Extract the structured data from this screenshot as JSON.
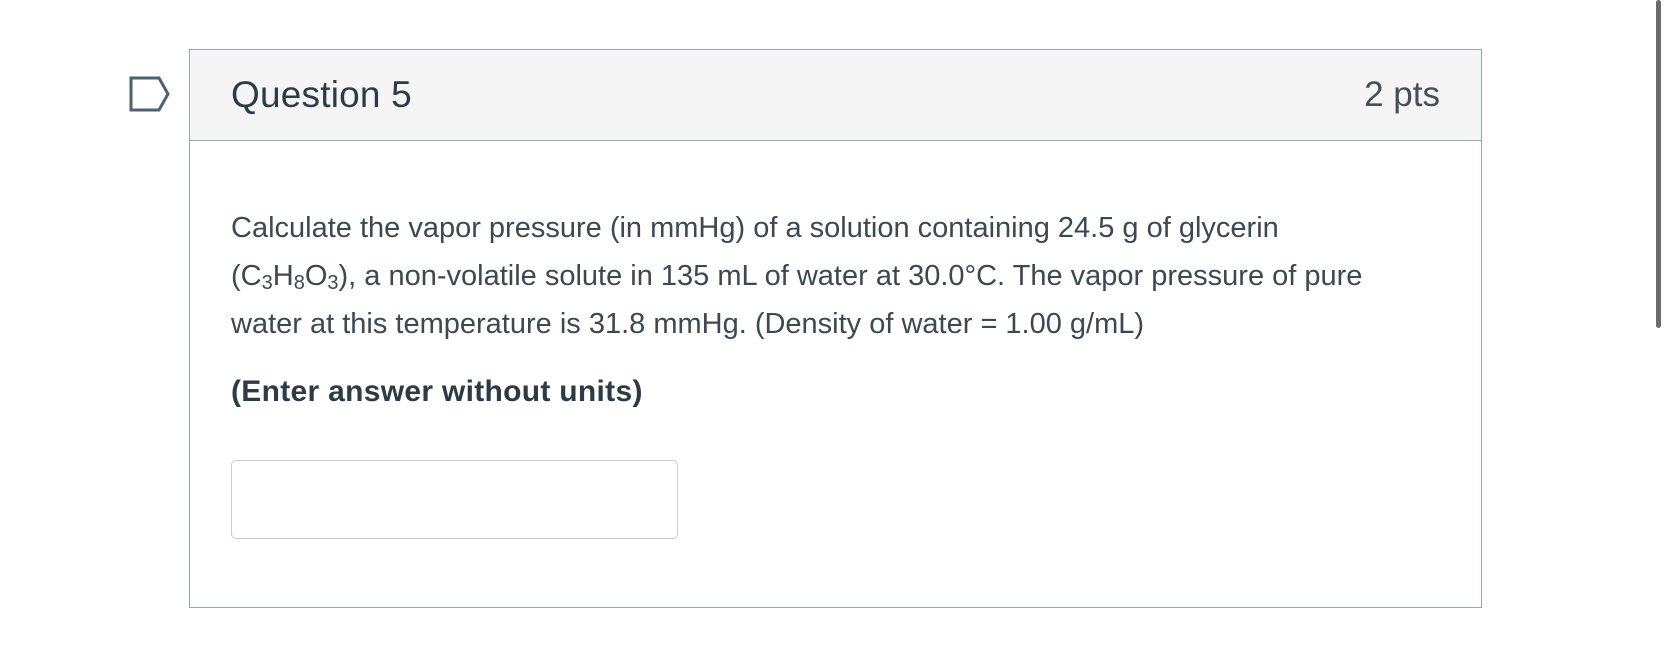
{
  "question": {
    "title": "Question 5",
    "points": "2 pts",
    "text": {
      "part1": "Calculate the vapor pressure (in mmHg) of a solution containing 24.5 g of glycerin (C",
      "sub1": "3",
      "part2": "H",
      "sub2": "8",
      "part3": "O",
      "sub3": "3",
      "part4": "), a non-volatile solute in 135 mL of water at 30.0°C.  The vapor pressure of pure water at this temperature is 31.8 mmHg.  (Density of water = 1.00 g/mL)"
    },
    "instruction": "(Enter answer without units)",
    "answer": {
      "value": "",
      "placeholder": ""
    }
  },
  "icons": {
    "flag": "bookmark-flag-icon"
  },
  "colors": {
    "header_bg": "#f5f5f5",
    "border": "#9aa4ab",
    "text": "#2d3b45",
    "flag": "#4b6272"
  }
}
